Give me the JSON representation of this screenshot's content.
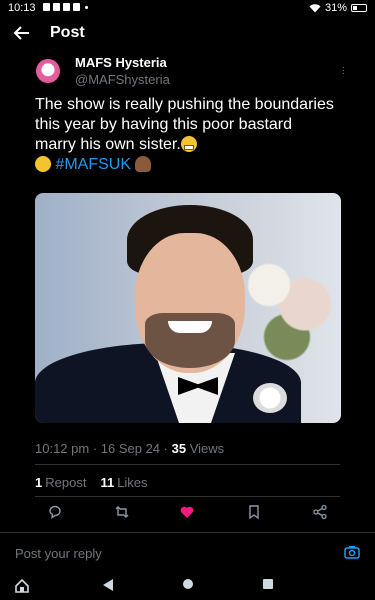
{
  "status_bar": {
    "time": "10:13",
    "battery": "31%",
    "battery_level": 0.31
  },
  "header": {
    "title": "Post"
  },
  "author": {
    "name": "MAFS Hysteria",
    "handle": "@MAFShysteria"
  },
  "tweet": {
    "text_part1": "The show is really pushing the boundaries this year by having this poor bastard marry his own sister.",
    "hashtag": "#MAFSUK"
  },
  "meta": {
    "time": "10:12 pm",
    "sep1": " · ",
    "date": "16 Sep 24",
    "sep2": " · ",
    "views_count": "35",
    "views_label": "Views"
  },
  "stats": {
    "reposts_count": "1",
    "reposts_label": "Repost",
    "likes_count": "11",
    "likes_label": "Likes"
  },
  "actions": [
    "reply-icon",
    "repost-icon",
    "like-icon",
    "bookmark-icon",
    "share-icon"
  ],
  "reply": {
    "placeholder": "Post your reply"
  },
  "colors": {
    "accent": "#1d9bf0",
    "like": "#f91880",
    "muted": "#71767b",
    "background": "#000000"
  },
  "nav": [
    "home-icon",
    "back-triangle-icon",
    "home-circle-icon",
    "recents-square-icon"
  ]
}
